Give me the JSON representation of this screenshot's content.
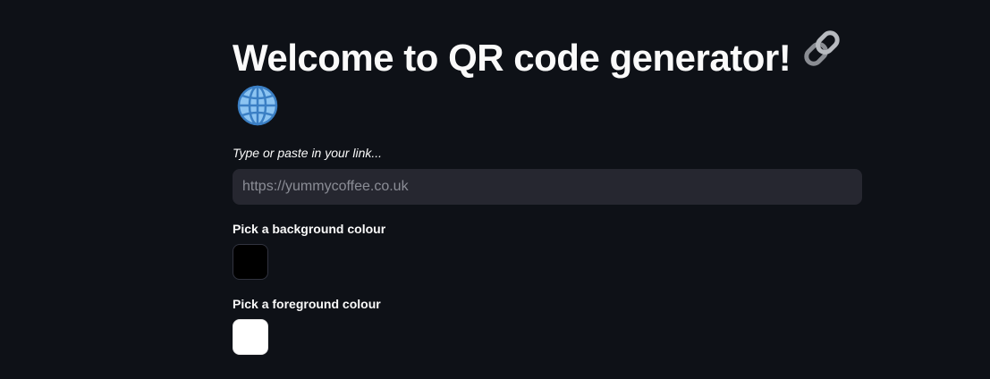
{
  "header": {
    "title": "Welcome to QR code generator!",
    "title_icons": [
      "link-icon",
      "globe-icon"
    ]
  },
  "link_input": {
    "caption": "Type or paste in your link...",
    "placeholder": "https://yummycoffee.co.uk",
    "value": ""
  },
  "background_picker": {
    "label": "Pick a background colour",
    "color": "#000000"
  },
  "foreground_picker": {
    "label": "Pick a foreground colour",
    "color": "#ffffff"
  },
  "theme": {
    "page_bg": "#0e1117",
    "input_bg": "#262730",
    "text": "#fafafa"
  }
}
